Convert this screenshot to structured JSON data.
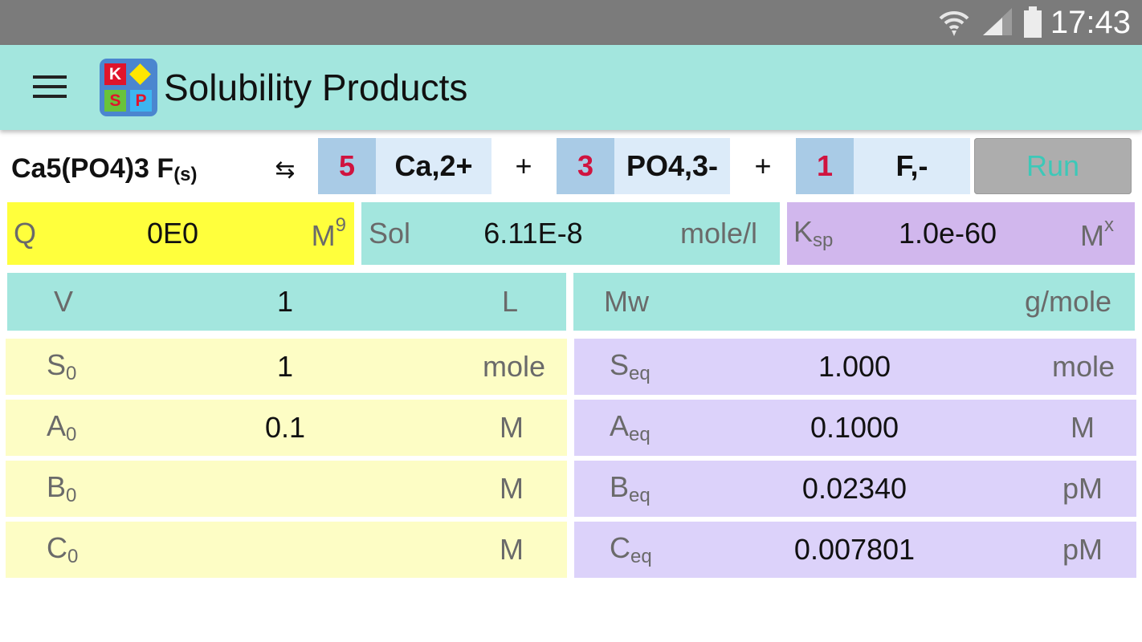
{
  "status_bar": {
    "time": "17:43"
  },
  "app_bar": {
    "title": "Solubility Products",
    "logo_letters": [
      "K",
      "S",
      "P"
    ]
  },
  "equation": {
    "compound": "Ca5(PO4)3 F",
    "state": "(s)",
    "arrow": "⇆",
    "terms": [
      {
        "coef": "5",
        "ion": "Ca,2+"
      },
      {
        "coef": "3",
        "ion": "PO4,3-"
      },
      {
        "coef": "1",
        "ion": "F,-"
      }
    ],
    "plus": "+",
    "run_label": "Run"
  },
  "summary": {
    "q": {
      "label": "Q",
      "value": "0E0",
      "unit": "M",
      "unit_sup": "9"
    },
    "sol": {
      "label": "Sol",
      "value": "6.11E-8",
      "unit": "mole/l"
    },
    "ksp": {
      "label": "K",
      "label_sub": "sp",
      "value": "1.0e-60",
      "unit": "M",
      "unit_sup": "x"
    }
  },
  "volume": {
    "label": "V",
    "value": "1",
    "unit": "L"
  },
  "mw": {
    "label": "Mw",
    "value": "",
    "unit": "g/mole"
  },
  "initial": [
    {
      "label": "S",
      "sub": "0",
      "value": "1",
      "unit": "mole"
    },
    {
      "label": "A",
      "sub": "0",
      "value": "0.1",
      "unit": "M"
    },
    {
      "label": "B",
      "sub": "0",
      "value": "",
      "unit": "M"
    },
    {
      "label": "C",
      "sub": "0",
      "value": "",
      "unit": "M"
    }
  ],
  "equilibrium": [
    {
      "label": "S",
      "sub": "eq",
      "value": "1.000",
      "unit": "mole"
    },
    {
      "label": "A",
      "sub": "eq",
      "value": "0.1000",
      "unit": "M"
    },
    {
      "label": "B",
      "sub": "eq",
      "value": "0.02340",
      "unit": "pM"
    },
    {
      "label": "C",
      "sub": "eq",
      "value": "0.007801",
      "unit": "pM"
    }
  ],
  "colors": {
    "status_bar": "#7b7b7b",
    "app_bar": "#a3e6de",
    "q_bg": "#ffff3c",
    "sol_bg": "#a3e6de",
    "ksp_bg": "#d1b7ed",
    "initial_bg": "#fdfdc5",
    "equilibrium_bg": "#dcd2fa",
    "coef_text": "#d0133f",
    "run_text": "#3dc8b8"
  }
}
